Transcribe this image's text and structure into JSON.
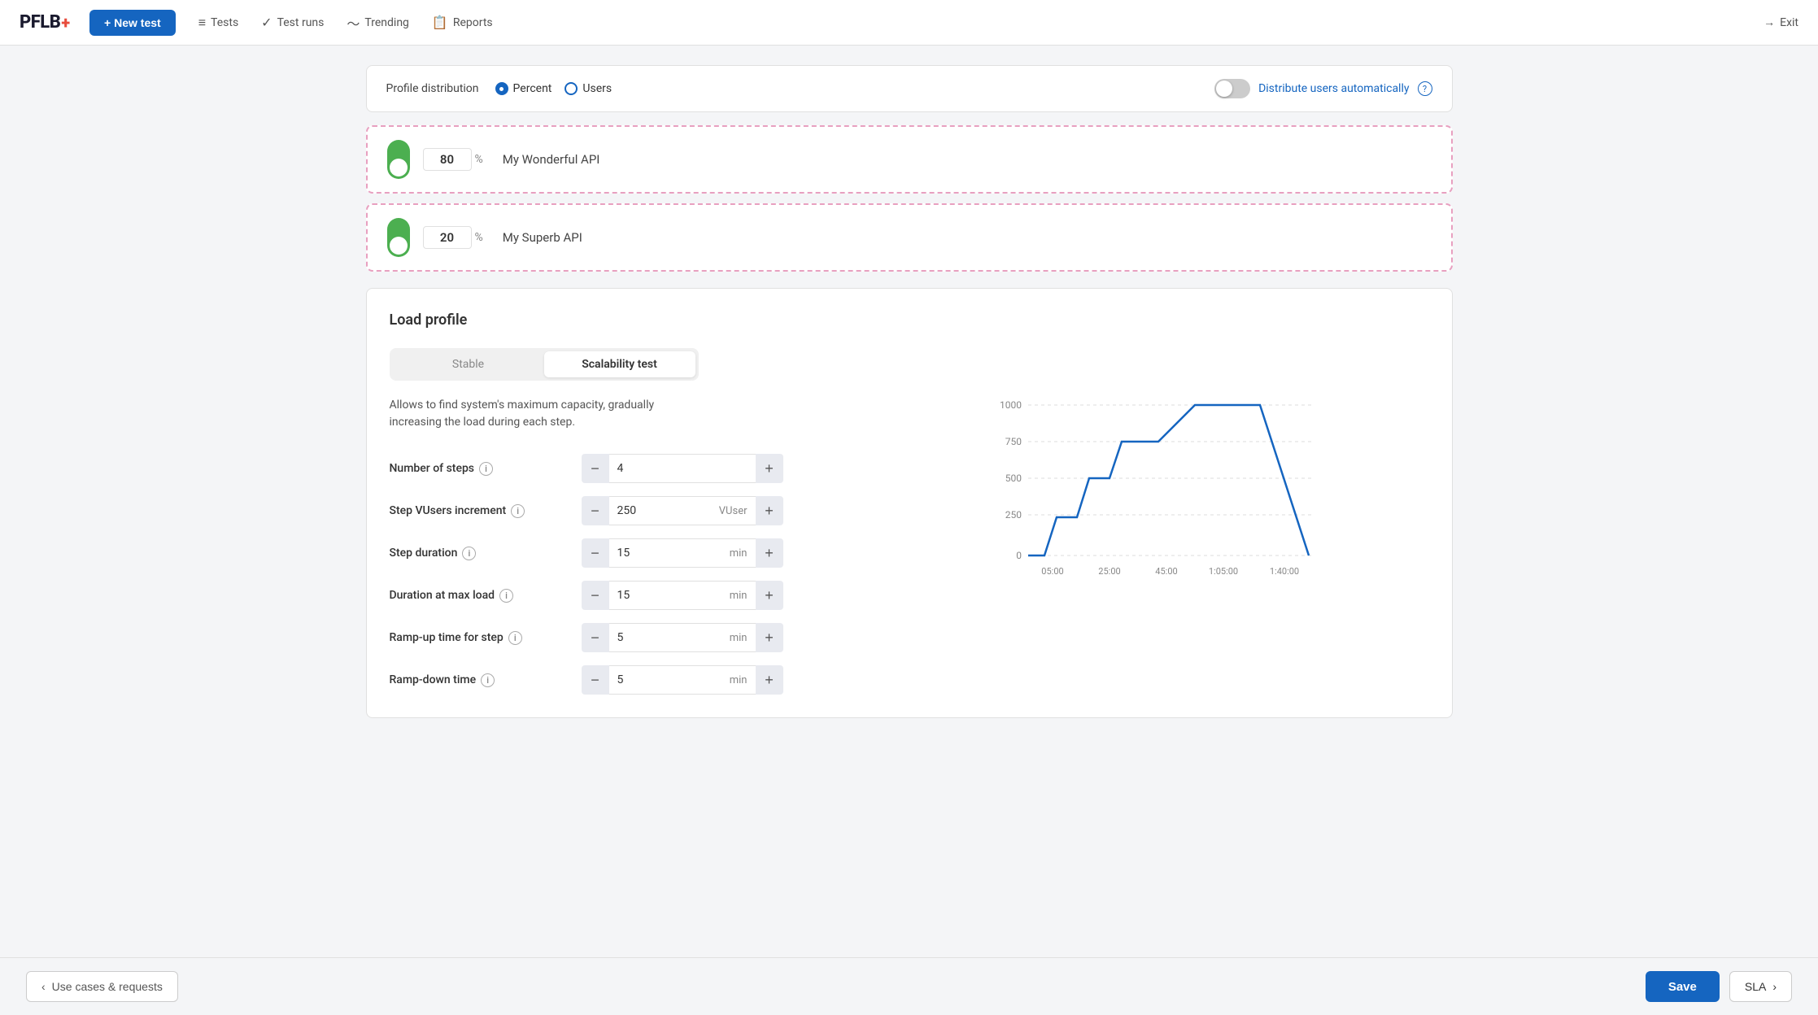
{
  "brand": {
    "name": "PFLB",
    "cross": "+"
  },
  "nav": {
    "new_test_label": "+ New test",
    "items": [
      {
        "id": "tests",
        "icon": "≡",
        "label": "Tests"
      },
      {
        "id": "test-runs",
        "icon": "✓",
        "label": "Test runs"
      },
      {
        "id": "trending",
        "icon": "∿",
        "label": "Trending"
      },
      {
        "id": "reports",
        "icon": "□",
        "label": "Reports"
      }
    ],
    "exit_label": "Exit"
  },
  "profile_distribution": {
    "label": "Profile distribution",
    "options": [
      "Percent",
      "Users"
    ],
    "selected": "Percent",
    "distribute_auto_label": "Distribute users automatically"
  },
  "api_cards": [
    {
      "id": "api1",
      "percent": "80",
      "name": "My Wonderful API"
    },
    {
      "id": "api2",
      "percent": "20",
      "name": "My Superb API"
    }
  ],
  "load_profile": {
    "title": "Load profile",
    "tabs": [
      {
        "id": "stable",
        "label": "Stable",
        "active": false
      },
      {
        "id": "scalability",
        "label": "Scalability test",
        "active": true
      }
    ],
    "description": "Allows to find system's maximum capacity, gradually increasing the load during each step.",
    "params": [
      {
        "id": "steps",
        "label": "Number of steps",
        "value": "4",
        "unit": ""
      },
      {
        "id": "vusers",
        "label": "Step VUsers increment",
        "value": "250",
        "unit": "VUser"
      },
      {
        "id": "duration",
        "label": "Step duration",
        "value": "15",
        "unit": "min"
      },
      {
        "id": "max-load-duration",
        "label": "Duration at max load",
        "value": "15",
        "unit": "min"
      },
      {
        "id": "ramp-up",
        "label": "Ramp-up time for step",
        "value": "5",
        "unit": "min"
      },
      {
        "id": "ramp-down",
        "label": "Ramp-down time",
        "value": "5",
        "unit": "min"
      }
    ],
    "chart": {
      "y_labels": [
        "1000",
        "750",
        "500",
        "250",
        "0"
      ],
      "x_labels": [
        "05:00",
        "25:00",
        "45:00",
        "1:05:00",
        "1:40:00"
      ],
      "color": "#1565c0"
    }
  },
  "bottom_bar": {
    "back_label": "Use cases & requests",
    "save_label": "Save",
    "sla_label": "SLA"
  }
}
